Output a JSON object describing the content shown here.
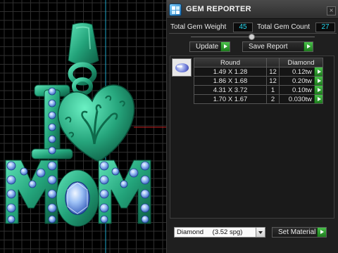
{
  "panel": {
    "title": "GEM REPORTER",
    "close_symbol": "×",
    "total_weight_label": "Total Gem Weight",
    "total_weight_value": "45",
    "total_count_label": "Total Gem Count",
    "total_count_value": "27",
    "update_label": "Update",
    "save_report_label": "Save Report",
    "gem_thumbnail_icon": "oval-gem-icon",
    "table": {
      "headers": [
        "Round",
        "",
        "Diamond"
      ],
      "rows": [
        {
          "size": "1.49 X 1.28",
          "count": "12",
          "weight": "0.12tw"
        },
        {
          "size": "1.86 X 1.68",
          "count": "12",
          "weight": "0.20tw"
        },
        {
          "size": "4.31 X 3.72",
          "count": "1",
          "weight": "0.10tw"
        },
        {
          "size": "1.70 X 1.67",
          "count": "2",
          "weight": "0.030tw"
        }
      ]
    },
    "material_name": "Diamond",
    "material_sg": "(3.52 spg)",
    "set_material_label": "Set Material"
  },
  "colors": {
    "panel_bg": "#1f1f1f",
    "value_text": "#27d9f0",
    "button_green": "#2fa02f",
    "model_green": "#1f8f6a",
    "gem_blue": "#8fb4f2",
    "grid_line": "#2f2f2f",
    "axis_cyan": "#1ea6c8",
    "axis_red": "#c81e1e"
  }
}
